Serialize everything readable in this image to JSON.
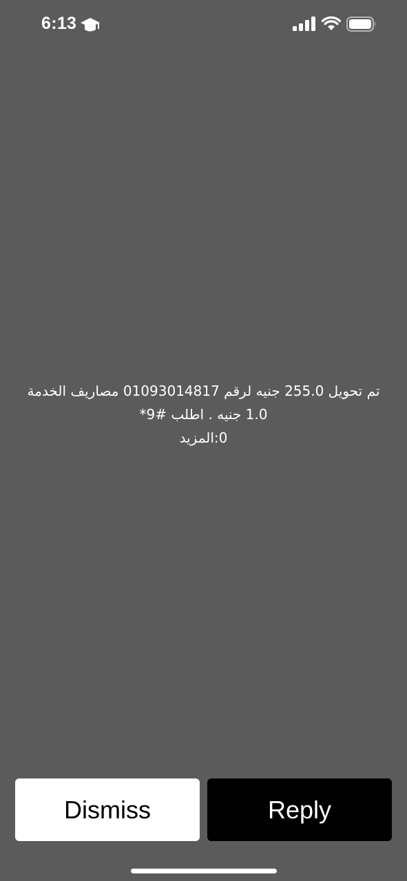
{
  "status_bar": {
    "time": "6:13",
    "icons": [
      "graduation-cap-icon",
      "cellular-signal-icon",
      "wifi-icon",
      "battery-icon"
    ]
  },
  "message": {
    "line1": "تم تحويل 255.0 جنيه لرقم 01093014817 مصاريف الخدمة",
    "line2": "1.0 جنيه . اطلب #9*",
    "line3": "0:المزيد"
  },
  "actions": {
    "dismiss_label": "Dismiss",
    "reply_label": "Reply"
  },
  "colors": {
    "background": "#5b5b5b",
    "dismiss_bg": "#ffffff",
    "reply_bg": "#000000",
    "text": "#ffffff"
  }
}
